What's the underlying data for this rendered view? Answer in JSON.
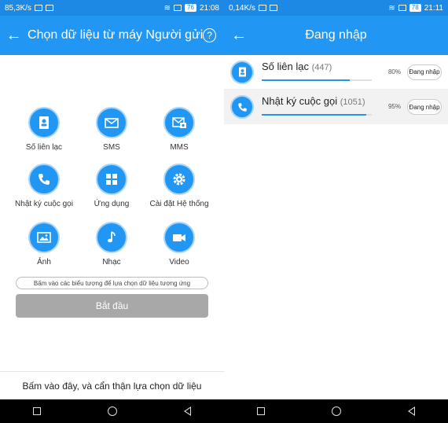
{
  "left": {
    "status": {
      "speed": "85,3K/s",
      "battery": "76",
      "time": "21:08"
    },
    "appbar": {
      "title": "Chọn dữ liệu từ máy Người gửi",
      "help": "?"
    },
    "items": [
      {
        "label": "Số liên lạc",
        "icon": "contacts-icon"
      },
      {
        "label": "SMS",
        "icon": "sms-icon"
      },
      {
        "label": "MMS",
        "icon": "mms-icon"
      },
      {
        "label": "Nhật ký cuộc gọi",
        "icon": "call-log-icon"
      },
      {
        "label": "Ứng dụng",
        "icon": "apps-icon"
      },
      {
        "label": "Cài đặt Hệ thống",
        "icon": "settings-icon"
      },
      {
        "label": "Ảnh",
        "icon": "photo-icon"
      },
      {
        "label": "Nhạc",
        "icon": "music-icon"
      },
      {
        "label": "Video",
        "icon": "video-icon"
      }
    ],
    "hint": "Bấm vào các biểu tượng để lựa chọn dữ liệu tương ứng",
    "start_button": "Bắt đầu",
    "bottom_text": "Bấm vào đây, và cẩn thận lựa chọn dữ liệu"
  },
  "right": {
    "status": {
      "speed": "0,14K/s",
      "battery": "78",
      "time": "21:11"
    },
    "appbar": {
      "title": "Đang nhập"
    },
    "rows": [
      {
        "name": "Số liên lạc",
        "count": "(447)",
        "percent": "80%",
        "progress": 0.8,
        "button": "Đang nhập",
        "icon": "contacts-icon"
      },
      {
        "name": "Nhật ký cuộc gọi",
        "count": "(1051)",
        "percent": "95%",
        "progress": 0.95,
        "button": "Đang nhập",
        "icon": "call-log-icon"
      }
    ]
  },
  "colors": {
    "accent": "#2196f3",
    "statusbar": "#1e88e5",
    "start_disabled": "#a8a8a8"
  }
}
